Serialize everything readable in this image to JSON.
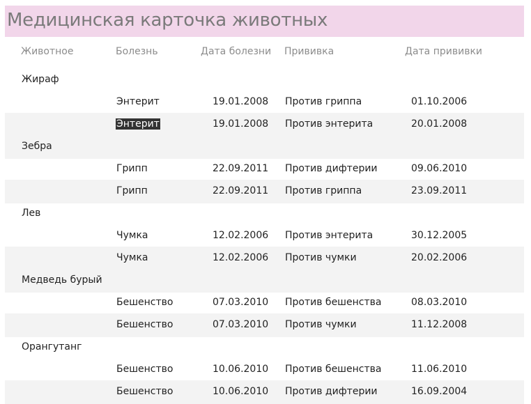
{
  "report": {
    "title": "Медицинская карточка животных",
    "columns": {
      "animal": "Животное",
      "disease": "Болезнь",
      "disease_date": "Дата болезни",
      "vaccine": "Прививка",
      "vaccine_date": "Дата прививки"
    },
    "rows": [
      {
        "kind": "group",
        "animal": "Жираф",
        "alt": false
      },
      {
        "kind": "detail",
        "disease": "Энтерит",
        "disease_date": "19.01.2008",
        "vaccine": "Против гриппа",
        "vaccine_date": "01.10.2006",
        "alt": false
      },
      {
        "kind": "detail",
        "disease": "Энтерит",
        "disease_date": "19.01.2008",
        "vaccine": "Против энтерита",
        "vaccine_date": "20.01.2008",
        "alt": true,
        "selected": true
      },
      {
        "kind": "group",
        "animal": "Зебра",
        "alt": true
      },
      {
        "kind": "detail",
        "disease": "Грипп",
        "disease_date": "22.09.2011",
        "vaccine": "Против дифтерии",
        "vaccine_date": "09.06.2010",
        "alt": false
      },
      {
        "kind": "detail",
        "disease": "Грипп",
        "disease_date": "22.09.2011",
        "vaccine": "Против гриппа",
        "vaccine_date": "23.09.2011",
        "alt": true
      },
      {
        "kind": "group",
        "animal": "Лев",
        "alt": false
      },
      {
        "kind": "detail",
        "disease": "Чумка",
        "disease_date": "12.02.2006",
        "vaccine": "Против энтерита",
        "vaccine_date": "30.12.2005",
        "alt": false
      },
      {
        "kind": "detail",
        "disease": "Чумка",
        "disease_date": "12.02.2006",
        "vaccine": "Против чумки",
        "vaccine_date": "20.02.2006",
        "alt": true
      },
      {
        "kind": "group",
        "animal": "Медведь бурый",
        "alt": true
      },
      {
        "kind": "detail",
        "disease": "Бешенство",
        "disease_date": "07.03.2010",
        "vaccine": "Против бешенства",
        "vaccine_date": "08.03.2010",
        "alt": false
      },
      {
        "kind": "detail",
        "disease": "Бешенство",
        "disease_date": "07.03.2010",
        "vaccine": "Против чумки",
        "vaccine_date": "11.12.2008",
        "alt": true
      },
      {
        "kind": "group",
        "animal": "Орангутанг",
        "alt": false
      },
      {
        "kind": "detail",
        "disease": "Бешенство",
        "disease_date": "10.06.2010",
        "vaccine": "Против бешенства",
        "vaccine_date": "11.06.2010",
        "alt": false
      },
      {
        "kind": "detail",
        "disease": "Бешенство",
        "disease_date": "10.06.2010",
        "vaccine": "Против дифтерии",
        "vaccine_date": "16.09.2004",
        "alt": true
      }
    ]
  },
  "colors": {
    "title_background": "#f2d6ea",
    "title_text": "#7a7a7a",
    "header_text": "#8c8c8c",
    "alt_row": "#f3f3f3",
    "selection": "#333333"
  }
}
